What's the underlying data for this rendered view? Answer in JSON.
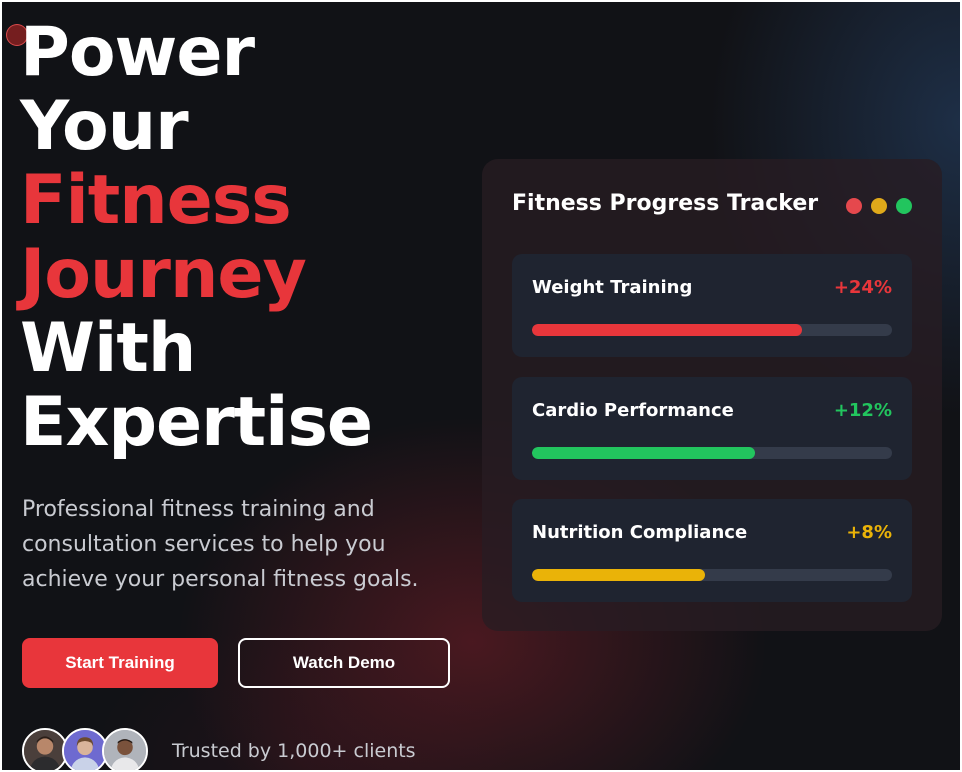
{
  "hero": {
    "headline_lines": [
      {
        "text": "Power",
        "accent": false
      },
      {
        "text": "Your",
        "accent": false
      },
      {
        "text": "Fitness",
        "accent": true
      },
      {
        "text": "Journey",
        "accent": true
      },
      {
        "text": "With",
        "accent": false
      },
      {
        "text": "Expertise",
        "accent": false
      }
    ],
    "subtext": "Professional fitness training and consultation services to help you achieve your personal fitness goals.",
    "primary_button": "Start Training",
    "secondary_button": "Watch Demo",
    "trusted_text": "Trusted by 1,000+ clients",
    "avatars": [
      "client-avatar-1",
      "client-avatar-2",
      "client-avatar-3"
    ]
  },
  "tracker": {
    "title": "Fitness Progress Tracker",
    "window_dots": [
      "#e5484d",
      "#e0a91a",
      "#22c55e"
    ],
    "metrics": [
      {
        "label": "Weight Training",
        "value": "+24%",
        "progress": 0.75,
        "color": "#e8363b"
      },
      {
        "label": "Cardio Performance",
        "value": "+12%",
        "progress": 0.62,
        "color": "#22c55e"
      },
      {
        "label": "Nutrition Compliance",
        "value": "+8%",
        "progress": 0.48,
        "color": "#eab308"
      }
    ]
  },
  "colors": {
    "accent": "#e8363b",
    "background": "#111216",
    "card_background": "#1f2430"
  }
}
